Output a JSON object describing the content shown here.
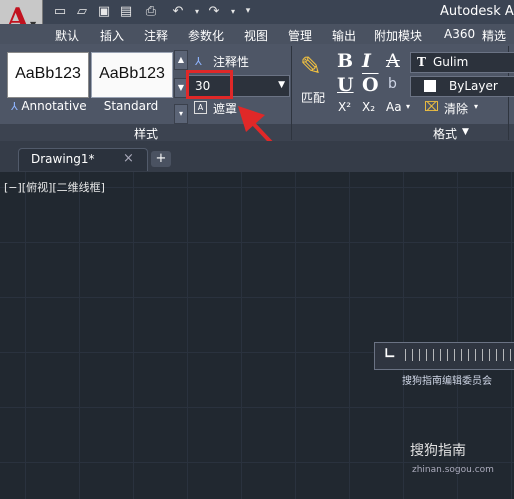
{
  "window": {
    "title": "Autodesk Au"
  },
  "menu": {
    "items": [
      "默认",
      "插入",
      "注释",
      "参数化",
      "视图",
      "管理",
      "输出",
      "附加模块",
      "A360",
      "精选"
    ]
  },
  "ribbon": {
    "styles": {
      "cards": [
        {
          "preview": "AaBb123",
          "name": "Annotative"
        },
        {
          "preview": "AaBb123",
          "name": "Standard"
        }
      ],
      "panel_label": "样式"
    },
    "annotative_label": "注释性",
    "text_height": {
      "value": "30"
    },
    "mask_label": "遮罩",
    "match_label": "匹配",
    "format": {
      "bold": "B",
      "italic": "I",
      "strike": "A",
      "underline": "U",
      "overline": "O",
      "oblique": "b",
      "superscript": "X²",
      "subscript": "X₂",
      "case": "Aa",
      "clear": "清除",
      "font": "Gulim",
      "color": "ByLayer",
      "panel_label": "格式"
    }
  },
  "drawing": {
    "tab": {
      "label": "Drawing1*",
      "close": "×",
      "new": "+"
    },
    "viewport_label": "[−][俯视][二维线框]"
  },
  "ruler": {
    "caption": "搜狗指南编辑委员会"
  },
  "watermark": {
    "text": "搜狗指南",
    "sub": "zhinan.sogou.com"
  },
  "colors": {
    "highlight": "#e02828",
    "brand": "#c1121f"
  }
}
